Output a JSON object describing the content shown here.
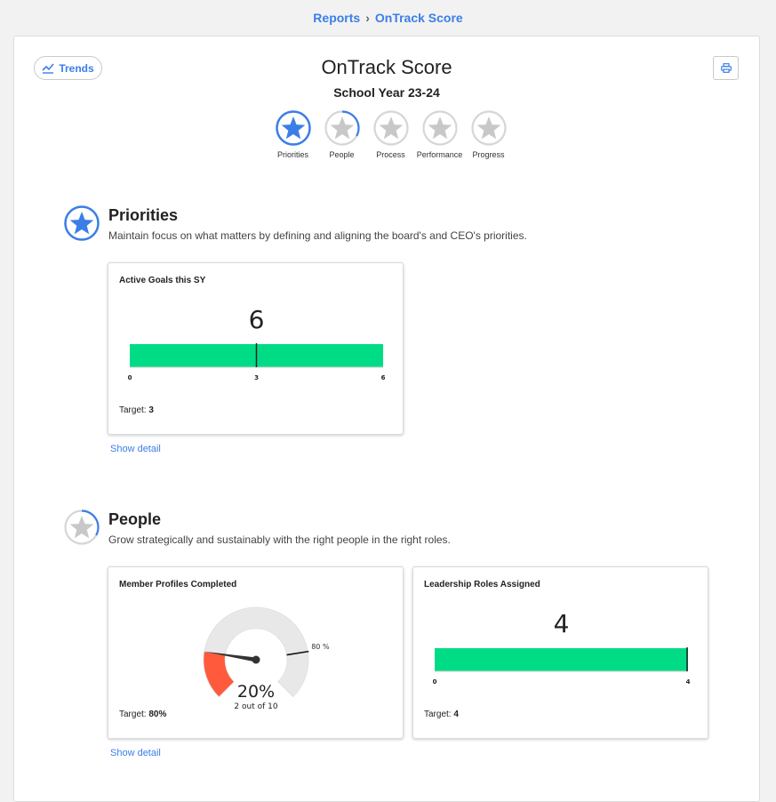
{
  "breadcrumb": {
    "items": [
      "Reports",
      "OnTrack Score"
    ],
    "separator": "›"
  },
  "header": {
    "trends_label": "Trends",
    "title": "OnTrack Score",
    "subtitle": "School Year 23-24",
    "print_icon": "printer-icon"
  },
  "steps": [
    {
      "label": "Priorities",
      "state": "complete",
      "progress": 1.0
    },
    {
      "label": "People",
      "state": "partial",
      "progress": 0.33
    },
    {
      "label": "Process",
      "state": "empty",
      "progress": 0
    },
    {
      "label": "Performance",
      "state": "empty",
      "progress": 0
    },
    {
      "label": "Progress",
      "state": "empty",
      "progress": 0
    }
  ],
  "colors": {
    "accent": "#3b7ee8",
    "bar_green": "#00dc86",
    "gauge_red": "#ff5a3c",
    "gauge_bg": "#e8e8e8",
    "star_grey": "#c8c8c8"
  },
  "sections": {
    "priorities": {
      "title": "Priorities",
      "description": "Maintain focus on what matters by defining and aligning the board's and CEO's priorities.",
      "icon_progress": 1.0,
      "show_detail": "Show detail",
      "cards": [
        {
          "title": "Active Goals this SY",
          "type": "bullet",
          "value": 6,
          "value_label": "6",
          "min": 0,
          "max": 6,
          "target": 3,
          "ticks": [
            "0",
            "3",
            "6"
          ],
          "target_label": "Target: ",
          "target_value": "3"
        }
      ]
    },
    "people": {
      "title": "People",
      "description": "Grow strategically and sustainably with the right people in the right roles.",
      "icon_progress": 0.33,
      "show_detail": "Show detail",
      "cards": [
        {
          "title": "Member Profiles Completed",
          "type": "gauge",
          "value_percent": 20,
          "value_label": "20%",
          "sub_label": "2 out of 10",
          "target_percent": 80,
          "target_marker_label": "80 %",
          "target_label": "Target: ",
          "target_value": "80%"
        },
        {
          "title": "Leadership Roles Assigned",
          "type": "bullet",
          "value": 4,
          "value_label": "4",
          "min": 0,
          "max": 4,
          "target": 4,
          "ticks": [
            "0",
            "4"
          ],
          "target_label": "Target: ",
          "target_value": "4"
        }
      ]
    }
  }
}
